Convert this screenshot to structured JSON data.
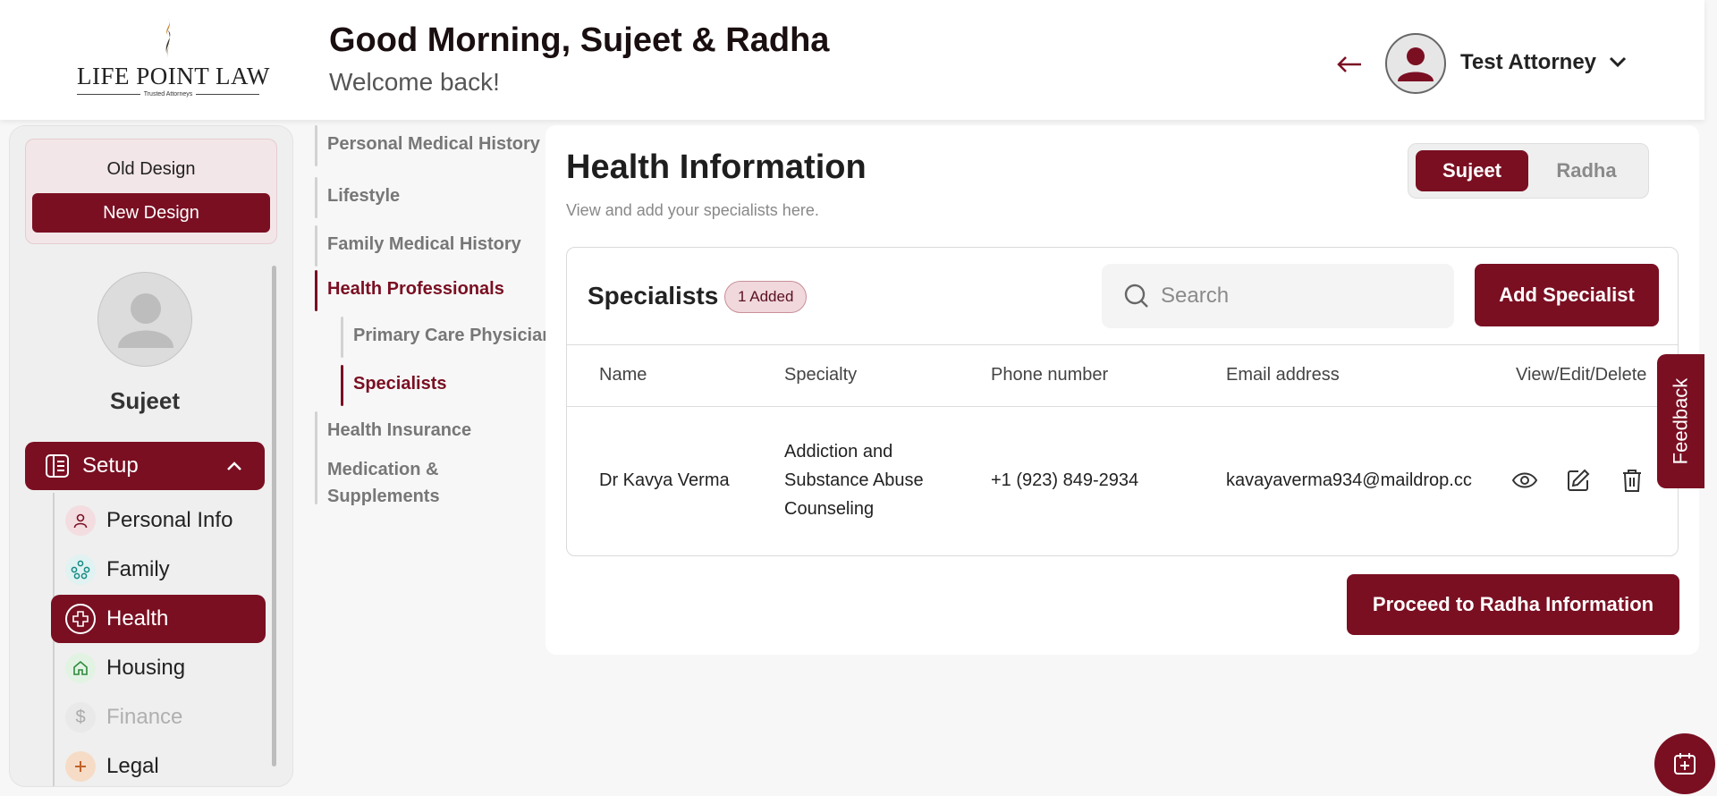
{
  "header": {
    "logo_text": "LIFE POINT LAW",
    "logo_tagline": "Trusted Attorneys",
    "greeting": "Good Morning, Sujeet & Radha",
    "welcome": "Welcome back!",
    "user_name": "Test Attorney"
  },
  "sidebar": {
    "old_design_label": "Old Design",
    "new_design_label": "New Design",
    "profile_name": "Sujeet",
    "setup_label": "Setup",
    "items": [
      {
        "label": "Personal Info",
        "icon": "person-icon"
      },
      {
        "label": "Family",
        "icon": "family-icon"
      },
      {
        "label": "Health",
        "icon": "health-cross-icon"
      },
      {
        "label": "Housing",
        "icon": "house-icon"
      },
      {
        "label": "Finance",
        "icon": "dollar-icon"
      },
      {
        "label": "Legal",
        "icon": "legal-icon"
      }
    ]
  },
  "subnav": {
    "items": [
      "Personal Medical History",
      "Lifestyle",
      "Family Medical History",
      "Health Professionals",
      "Primary Care Physician",
      "Specialists",
      "Health Insurance",
      "Medication &",
      "Supplements"
    ]
  },
  "main": {
    "title": "Health Information",
    "subtitle": "View and add your specialists here.",
    "toggle": {
      "active": "Sujeet",
      "inactive": "Radha"
    },
    "card": {
      "title": "Specialists",
      "badge": "1 Added",
      "search_placeholder": "Search",
      "add_button": "Add Specialist",
      "columns": [
        "Name",
        "Specialty",
        "Phone number",
        "Email address",
        "View/Edit/Delete"
      ],
      "rows": [
        {
          "name": "Dr Kavya Verma",
          "specialty_lines": [
            "Addiction and",
            "Substance Abuse",
            "Counseling"
          ],
          "phone": "+1 (923) 849-2934",
          "email": "kavayaverma934@maildrop.cc"
        }
      ]
    },
    "proceed_button": "Proceed to Radha Information"
  },
  "feedback_label": "Feedback",
  "colors": {
    "brand": "#7a0f22",
    "badge_bg": "#f0d8dc"
  }
}
